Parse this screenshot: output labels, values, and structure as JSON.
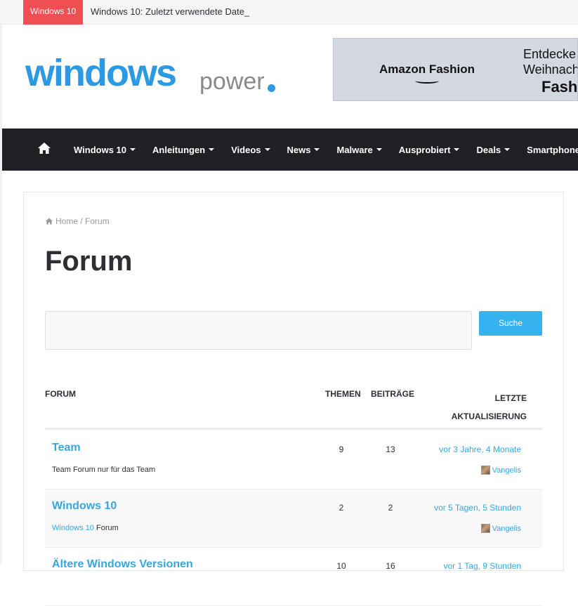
{
  "topbar": {
    "tag": "Windows 10",
    "ticker": "Windows 10: Zuletzt verwendete Date_"
  },
  "logo": {
    "part1": "windows",
    "part2": "power"
  },
  "ad": {
    "brand": "Amazon Fashion",
    "line1": "Entdecke",
    "line2": "Weihnach",
    "line3": "Fash"
  },
  "nav": {
    "home_icon": "home-icon",
    "items": [
      {
        "label": "Windows 10"
      },
      {
        "label": "Anleitungen"
      },
      {
        "label": "Videos"
      },
      {
        "label": "News"
      },
      {
        "label": "Malware"
      },
      {
        "label": "Ausprobiert"
      },
      {
        "label": "Deals"
      },
      {
        "label": "Smartphone"
      }
    ]
  },
  "breadcrumb": {
    "home": "Home",
    "sep": "/",
    "current": "Forum"
  },
  "page": {
    "title": "Forum"
  },
  "search": {
    "value": "",
    "button": "Suche"
  },
  "table": {
    "headers": {
      "forum": "FORUM",
      "themen": "THEMEN",
      "beitraege": "BEITRÄGE",
      "letzte1": "LETZTE",
      "letzte2": "AKTUALISIERUNG"
    },
    "rows": [
      {
        "name": "Team",
        "desc_link": "",
        "desc": "Team Forum nur für das Team",
        "themen": "9",
        "beitraege": "13",
        "time": "vor 3 Jahre, 4 Monate",
        "user": "Vangelis"
      },
      {
        "name": "Windows 10",
        "desc_link": "Windows 10",
        "desc": " Forum",
        "themen": "2",
        "beitraege": "2",
        "time": "vor 5 Tagen, 5 Stunden",
        "user": "Vangelis"
      },
      {
        "name": "Ältere Windows Versionen",
        "desc_link": "",
        "desc": "",
        "themen": "10",
        "beitraege": "16",
        "time": "vor 1 Tag, 9 Stunden",
        "user": ""
      }
    ]
  }
}
